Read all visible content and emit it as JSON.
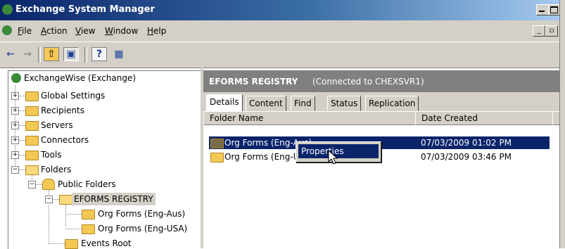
{
  "window": {
    "title": "Exchange System Manager",
    "title_color": "#0a246a"
  },
  "menu": {
    "items": [
      {
        "label": "File",
        "underline": "F",
        "rest": "ile"
      },
      {
        "label": "Action",
        "underline": "A",
        "rest": "ction"
      },
      {
        "label": "View",
        "underline": "V",
        "rest": "iew"
      },
      {
        "label": "Window",
        "underline": "W",
        "rest": "indow"
      },
      {
        "label": "Help",
        "underline": "H",
        "rest": "elp"
      }
    ]
  },
  "toolbar": {
    "back_icon": "←",
    "forward_icon": "→",
    "up_icon": "⇧",
    "show_hide_tree_icon": "▣",
    "help_icon": "?",
    "properties_icon": "▦"
  },
  "tree": {
    "root": "ExchangeWise (Exchange)",
    "nodes": [
      {
        "label": "Global Settings",
        "expander": "+"
      },
      {
        "label": "Recipients",
        "expander": "+"
      },
      {
        "label": "Servers",
        "expander": "+"
      },
      {
        "label": "Connectors",
        "expander": "+"
      },
      {
        "label": "Tools",
        "expander": "+"
      },
      {
        "label": "Folders",
        "expander": "−"
      }
    ],
    "public_folders": "Public Folders",
    "eforms": "EFORMS REGISTRY",
    "children": [
      "Org Forms (Eng-Aus)",
      "Org Forms (Eng-USA)"
    ],
    "events_root": "Events Root"
  },
  "header": {
    "title": "EFORMS REGISTRY",
    "subtitle": "(Connected to CHEXSVR1)"
  },
  "tabs": [
    "Details",
    "Content",
    "Find",
    "Status",
    "Replication"
  ],
  "columns": {
    "name": "Folder Name",
    "date": "Date Created"
  },
  "rows": [
    {
      "name": "Org Forms (Eng-Aus)",
      "date": "07/03/2009  01:02 PM",
      "selected": true
    },
    {
      "name": "Org Forms (Eng-USA)",
      "date": "07/03/2009  03:46 PM",
      "selected": false
    }
  ],
  "context_menu": {
    "item": "Properties"
  }
}
